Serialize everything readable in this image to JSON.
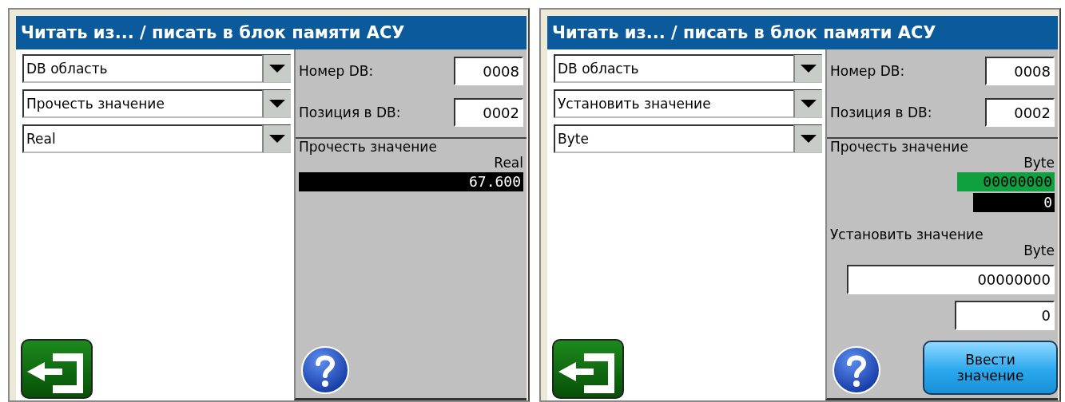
{
  "panels": [
    {
      "title": "Читать из... / писать в блок памяти АСУ",
      "dropdowns": [
        {
          "value": "DB область"
        },
        {
          "value": "Прочесть значение"
        },
        {
          "value": "Real"
        }
      ],
      "db_number": {
        "label": "Номер DB:",
        "value": "0008"
      },
      "db_position": {
        "label": "Позиция в DB:",
        "value": "0002"
      },
      "read_section": {
        "heading": "Прочесть значение",
        "type": "Real",
        "readouts": [
          {
            "kind": "value",
            "text": "67.600"
          }
        ]
      }
    },
    {
      "title": "Читать из... / писать в блок памяти АСУ",
      "dropdowns": [
        {
          "value": "DB область"
        },
        {
          "value": "Установить значение"
        },
        {
          "value": "Byte"
        }
      ],
      "db_number": {
        "label": "Номер DB:",
        "value": "0008"
      },
      "db_position": {
        "label": "Позиция в DB:",
        "value": "0002"
      },
      "read_section": {
        "heading": "Прочесть значение",
        "type": "Byte",
        "readouts": [
          {
            "kind": "binary",
            "text": "00000000"
          },
          {
            "kind": "value",
            "text": "0"
          }
        ]
      },
      "write_section": {
        "heading": "Установить значение",
        "type": "Byte",
        "fields": [
          {
            "value": "00000000"
          },
          {
            "value": "0"
          }
        ]
      },
      "enter_button": {
        "label": "Ввести значение"
      }
    }
  ]
}
